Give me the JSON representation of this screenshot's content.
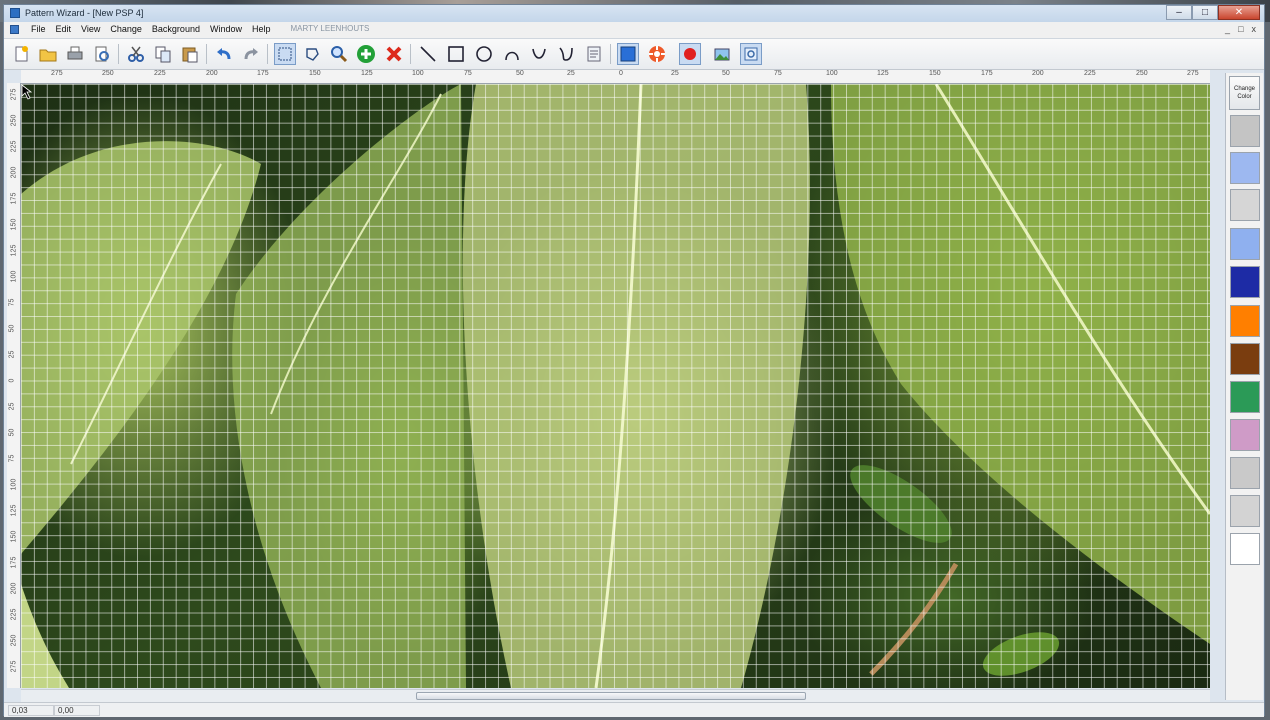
{
  "window": {
    "title": "Pattern Wizard - [New PSP 4]",
    "controls": [
      "–",
      "□",
      "✕"
    ]
  },
  "menu": {
    "items": [
      "File",
      "Edit",
      "View",
      "Change",
      "Background",
      "Window",
      "Help"
    ],
    "watermark": "MARTY LEENHOUTS",
    "mdi_controls": [
      "_",
      "□",
      "x"
    ]
  },
  "toolbar": {
    "tools": [
      {
        "name": "new-file-icon",
        "active": false
      },
      {
        "name": "open-folder-icon",
        "active": false
      },
      {
        "name": "print-icon",
        "active": false
      },
      {
        "name": "print-preview-icon",
        "active": false
      },
      {
        "name": "cut-icon",
        "active": false
      },
      {
        "name": "copy-icon",
        "active": false
      },
      {
        "name": "paste-icon",
        "active": false
      },
      {
        "name": "undo-icon",
        "active": false
      },
      {
        "name": "redo-icon",
        "active": false
      },
      {
        "name": "select-rectangle-icon",
        "active": true
      },
      {
        "name": "lasso-icon",
        "active": false
      },
      {
        "name": "zoom-icon",
        "active": false
      },
      {
        "name": "add-node-icon",
        "active": false
      },
      {
        "name": "delete-node-icon",
        "active": false
      },
      {
        "name": "line-tool-icon",
        "active": false
      },
      {
        "name": "rectangle-tool-icon",
        "active": false
      },
      {
        "name": "circle-tool-icon",
        "active": false
      },
      {
        "name": "arc-tool-icon",
        "active": false
      },
      {
        "name": "curve-tool-icon",
        "active": false
      },
      {
        "name": "bezier-tool-icon",
        "active": false
      },
      {
        "name": "properties-icon",
        "active": false
      },
      {
        "name": "fill-color-icon",
        "active": true
      },
      {
        "name": "lifesaver-icon",
        "active": false
      },
      {
        "name": "record-icon",
        "active": true
      },
      {
        "name": "background-image-icon",
        "active": false
      },
      {
        "name": "fit-view-icon",
        "active": true
      }
    ]
  },
  "rulers": {
    "horizontal": [
      "275",
      "250",
      "225",
      "200",
      "175",
      "150",
      "125",
      "100",
      "75",
      "50",
      "25",
      "0",
      "25",
      "50",
      "75",
      "100",
      "125",
      "150",
      "175",
      "200",
      "225",
      "250",
      "275"
    ],
    "vertical": [
      "275",
      "250",
      "225",
      "200",
      "175",
      "150",
      "125",
      "100",
      "75",
      "50",
      "25",
      "0",
      "25",
      "50",
      "75",
      "100",
      "125",
      "150",
      "175",
      "200",
      "225",
      "250",
      "275"
    ]
  },
  "palette": {
    "change_color_label": "Change Color",
    "swatches": [
      "#c4c4c4",
      "#9db8f0",
      "#d6d6d6",
      "#8fb0ef",
      "#1d2ba5",
      "#ff7f00",
      "#7a3d0f",
      "#2b9a57",
      "#cf9bc7",
      "#c9c9c9",
      "#d3d3d3",
      "#ffffff"
    ]
  },
  "status": {
    "x": "0,03",
    "y": "0,00"
  }
}
